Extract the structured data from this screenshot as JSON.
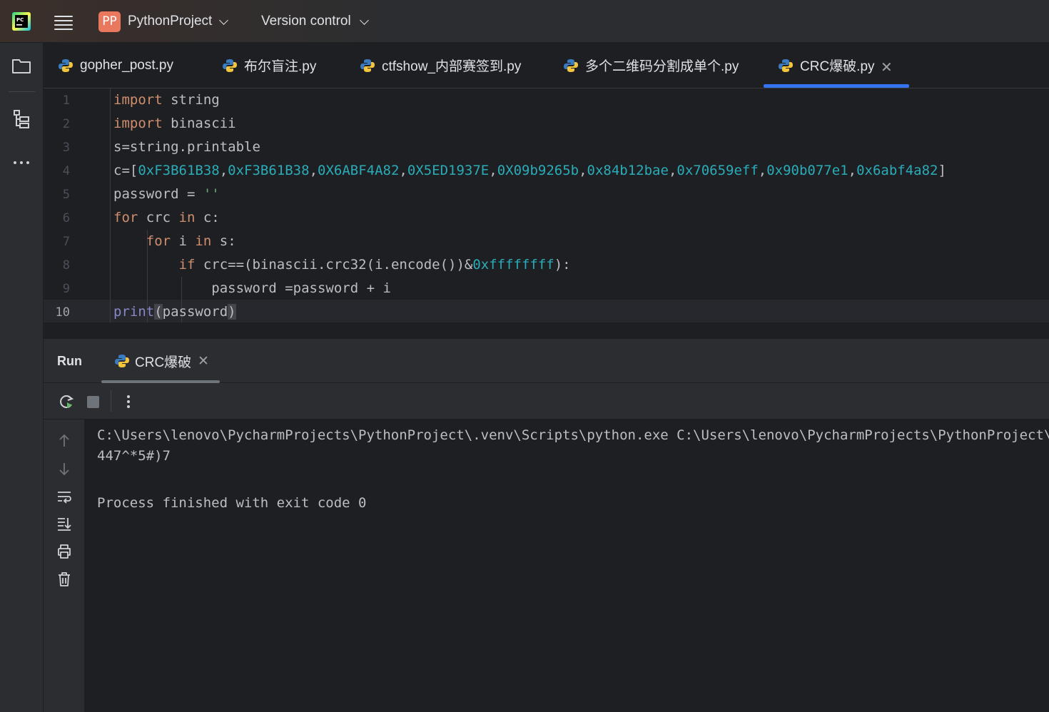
{
  "titlebar": {
    "project_badge": "PP",
    "project_name": "PythonProject",
    "vcs_label": "Version control"
  },
  "tabs": [
    {
      "label": "gopher_post.py",
      "active": false
    },
    {
      "label": "布尔盲注.py",
      "active": false
    },
    {
      "label": "ctfshow_内部赛签到.py",
      "active": false
    },
    {
      "label": "多个二维码分割成单个.py",
      "active": false
    },
    {
      "label": "CRC爆破.py",
      "active": true
    }
  ],
  "editor": {
    "line_numbers": [
      "1",
      "2",
      "3",
      "4",
      "5",
      "6",
      "7",
      "8",
      "9",
      "10"
    ],
    "current_line": "10",
    "code": {
      "l1_kw": "import",
      "l1_rest": " string",
      "l2_kw": "import",
      "l2_rest": " binascii",
      "l3": "s=string.printable",
      "l4_pre": "c=[",
      "l4_values": [
        "0xF3B61B38",
        "0xF3B61B38",
        "0X6ABF4A82",
        "0X5ED1937E",
        "0X09b9265b",
        "0x84b12bae",
        "0x70659eff",
        "0x90b077e1",
        "0x6abf4a82"
      ],
      "l4_post": "]",
      "l5_pre": "password = ",
      "l5_str": "''",
      "l6_kw1": "for",
      "l6_mid": " crc ",
      "l6_kw2": "in",
      "l6_rest": " c:",
      "l7_kw1": "for",
      "l7_mid": " i ",
      "l7_kw2": "in",
      "l7_rest": " s:",
      "l8_kw": "if",
      "l8_mid": " crc==(binascii.crc32(i.encode())&",
      "l8_num": "0xffffffff",
      "l8_rest": "):",
      "l9": "password =password + i",
      "l10_fn": "print",
      "l10_open": "(",
      "l10_arg": "password",
      "l10_close": ")"
    }
  },
  "run": {
    "title": "Run",
    "tab_label": "CRC爆破",
    "console_lines": [
      "C:\\Users\\lenovo\\PycharmProjects\\PythonProject\\.venv\\Scripts\\python.exe C:\\Users\\lenovo\\PycharmProjects\\PythonProject\\CRC爆破.py",
      "447^*5#)7",
      "",
      "Process finished with exit code 0"
    ]
  },
  "colors": {
    "accent": "#3574f0",
    "keyword": "#cf8e6d",
    "number": "#2aacb8",
    "string": "#6aab73",
    "builtin": "#8888c6",
    "project_badge": "#e9785f"
  }
}
